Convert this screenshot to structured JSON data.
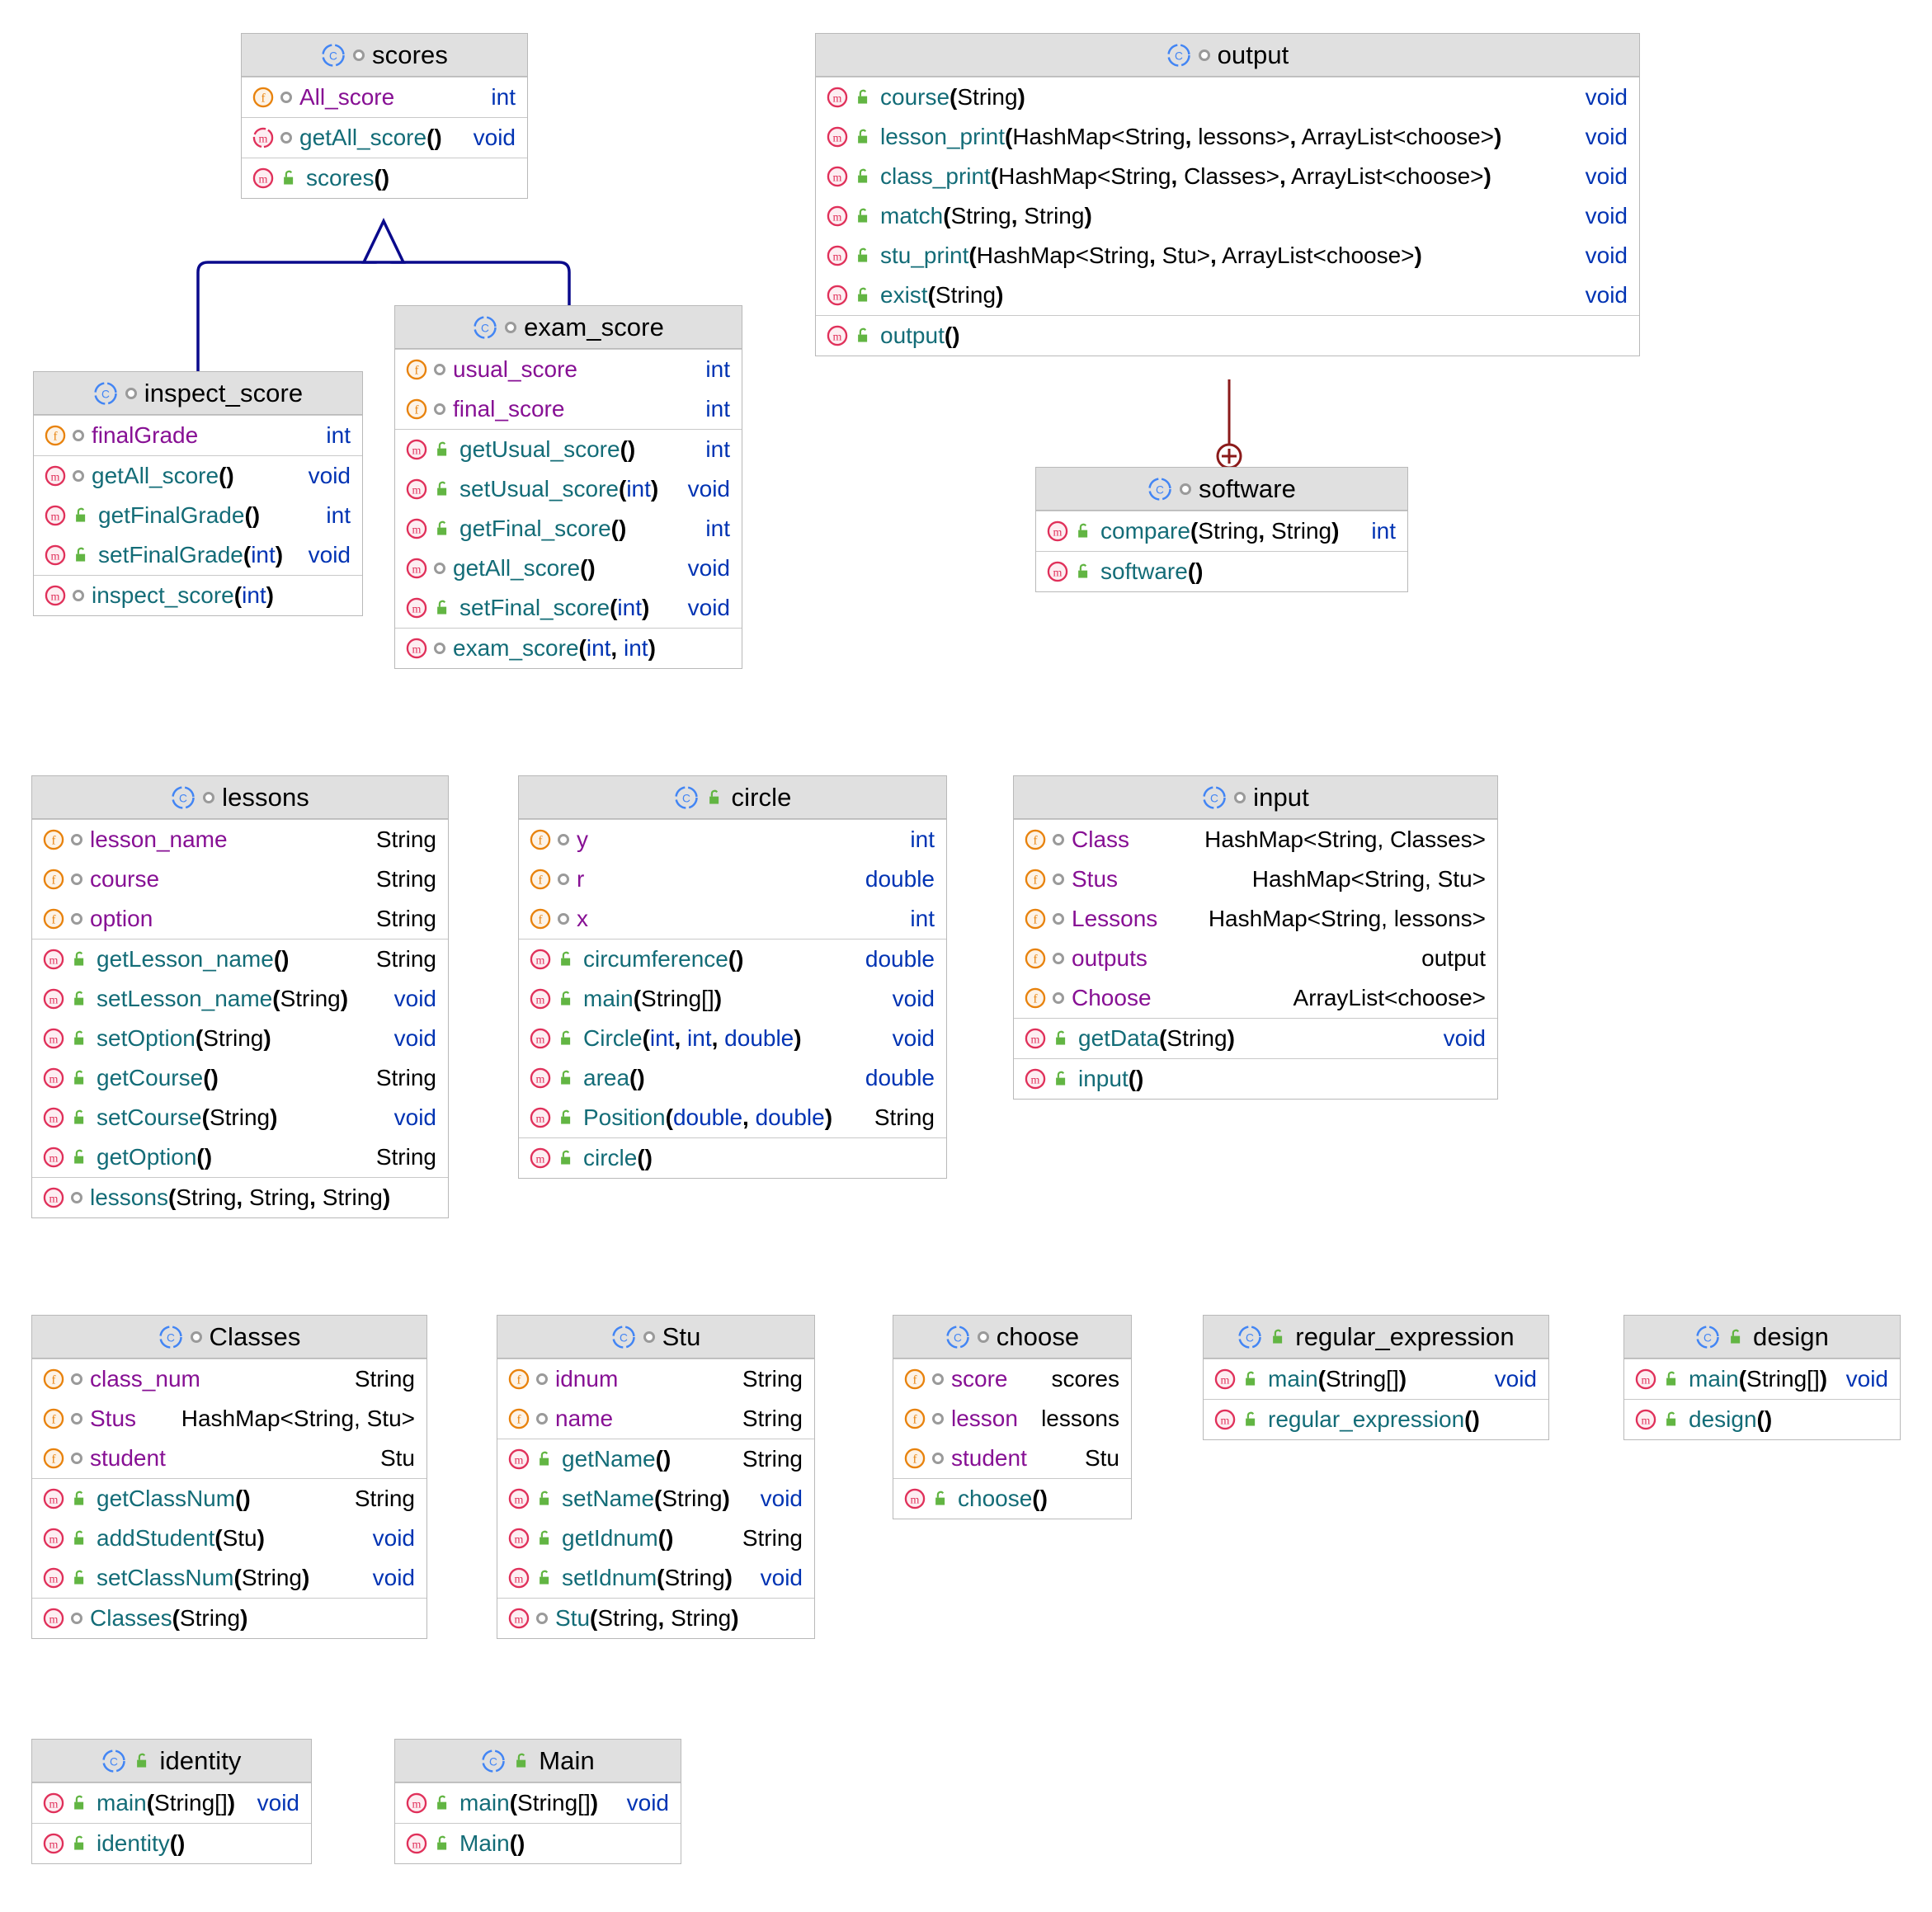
{
  "diagram": {
    "kind": "uml-class-diagram",
    "background": "#ffffff",
    "colors": {
      "header_bg": "#e0e0e0",
      "border": "#b9b9b9",
      "field_name": "#871094",
      "method_name": "#136c77",
      "primitive_type": "#0033b3",
      "object_type": "#000000",
      "class_icon": "#4285f4",
      "field_icon": "#e8820c",
      "method_icon": "#e0305a",
      "lock_icon": "#62b543",
      "inheritance_line": "#0a0a8c",
      "inner_class_line": "#8b1a1a"
    },
    "icons": {
      "class": "class-icon",
      "field": "field-icon",
      "method": "method-icon",
      "public": "public-unlock-icon",
      "package": "package-private-dot-icon"
    },
    "relations": [
      {
        "type": "inheritance",
        "from": "inspect_score",
        "to": "scores"
      },
      {
        "type": "inheritance",
        "from": "exam_score",
        "to": "scores"
      },
      {
        "type": "inner-class",
        "from": "output",
        "to": "software",
        "marker": "+"
      }
    ]
  },
  "classes": [
    {
      "id": "scores",
      "name": "scores",
      "vis": "package",
      "sections": [
        [
          {
            "k": "f",
            "v": "package",
            "sig": [
              {
                "t": "scores",
                "c": "nmF"
              }
            ],
            "type": "int",
            "tc": "tprim"
          }
        ],
        [
          {
            "k": "m",
            "v": "package",
            "sig": [
              {
                "t": "getAll_score",
                "c": "nmM"
              },
              {
                "t": "()",
                "c": "punct"
              }
            ],
            "type": "void",
            "tc": "tprim"
          }
        ],
        [
          {
            "k": "m",
            "v": "public",
            "sig": [
              {
                "t": "scores",
                "c": "nmM"
              },
              {
                "t": "()",
                "c": "punct"
              }
            ],
            "type": "",
            "tc": "tprim"
          }
        ]
      ],
      "rowtexts": [
        "All_score",
        "getAll_score()",
        "scores()"
      ]
    },
    {
      "id": "inspect_score",
      "name": "inspect_score",
      "vis": "package"
    },
    {
      "id": "exam_score",
      "name": "exam_score",
      "vis": "package"
    },
    {
      "id": "output",
      "name": "output",
      "vis": "package"
    },
    {
      "id": "software",
      "name": "software",
      "vis": "package"
    },
    {
      "id": "lessons",
      "name": "lessons",
      "vis": "package"
    },
    {
      "id": "circle",
      "name": "circle",
      "vis": "public"
    },
    {
      "id": "input",
      "name": "input",
      "vis": "package"
    },
    {
      "id": "Classes",
      "name": "Classes",
      "vis": "package"
    },
    {
      "id": "Stu",
      "name": "Stu",
      "vis": "package"
    },
    {
      "id": "choose",
      "name": "choose",
      "vis": "package"
    },
    {
      "id": "regular_expression",
      "name": "regular_expression",
      "vis": "public"
    },
    {
      "id": "design",
      "name": "design",
      "vis": "public"
    },
    {
      "id": "identity",
      "name": "identity",
      "vis": "public"
    },
    {
      "id": "Main",
      "name": "Main",
      "vis": "public"
    }
  ],
  "scores": {
    "title": "scores",
    "r0": {
      "name": "All_score",
      "type": "int"
    },
    "r1": {
      "name": "getAll_score()",
      "type": "void"
    },
    "r2": {
      "name": "scores()",
      "type": ""
    }
  },
  "inspect_score": {
    "title": "inspect_score",
    "r0": {
      "name": "finalGrade",
      "type": "int"
    },
    "r1": {
      "name": "getAll_score()",
      "type": "void"
    },
    "r2": {
      "name": "getFinalGrade()",
      "type": "int"
    },
    "r3": {
      "name": "setFinalGrade(int)",
      "type": "void"
    },
    "r4": {
      "name": "inspect_score(int)",
      "type": ""
    }
  },
  "exam_score": {
    "title": "exam_score",
    "r0": {
      "name": "usual_score",
      "type": "int"
    },
    "r1": {
      "name": "final_score",
      "type": "int"
    },
    "r2": {
      "name": "getUsual_score()",
      "type": "int"
    },
    "r3": {
      "name": "setUsual_score(int)",
      "type": "void"
    },
    "r4": {
      "name": "getFinal_score()",
      "type": "int"
    },
    "r5": {
      "name": "getAll_score()",
      "type": "void"
    },
    "r6": {
      "name": "setFinal_score(int)",
      "type": "void"
    },
    "r7": {
      "name": "exam_score(int, int)",
      "type": ""
    }
  },
  "output": {
    "title": "output",
    "r0": {
      "name": "course(String)",
      "type": "void"
    },
    "r1": {
      "name": "lesson_print(HashMap<String, lessons>, ArrayList<choose>)",
      "type": "void"
    },
    "r2": {
      "name": "class_print(HashMap<String, Classes>, ArrayList<choose>)",
      "type": "void"
    },
    "r3": {
      "name": "match(String, String)",
      "type": "void"
    },
    "r4": {
      "name": "stu_print(HashMap<String, Stu>, ArrayList<choose>)",
      "type": "void"
    },
    "r5": {
      "name": "exist(String)",
      "type": "void"
    },
    "r6": {
      "name": "output()",
      "type": ""
    }
  },
  "software": {
    "title": "software",
    "r0": {
      "name": "compare(String, String)",
      "type": "int"
    },
    "r1": {
      "name": "software()",
      "type": ""
    }
  },
  "lessons": {
    "title": "lessons",
    "r0": {
      "name": "lesson_name",
      "type": "String"
    },
    "r1": {
      "name": "course",
      "type": "String"
    },
    "r2": {
      "name": "option",
      "type": "String"
    },
    "r3": {
      "name": "getLesson_name()",
      "type": "String"
    },
    "r4": {
      "name": "setLesson_name(String)",
      "type": "void"
    },
    "r5": {
      "name": "setOption(String)",
      "type": "void"
    },
    "r6": {
      "name": "getCourse()",
      "type": "String"
    },
    "r7": {
      "name": "setCourse(String)",
      "type": "void"
    },
    "r8": {
      "name": "getOption()",
      "type": "String"
    },
    "r9": {
      "name": "lessons(String, String, String)",
      "type": ""
    }
  },
  "circle": {
    "title": "circle",
    "r0": {
      "name": "y",
      "type": "int"
    },
    "r1": {
      "name": "r",
      "type": "double"
    },
    "r2": {
      "name": "x",
      "type": "int"
    },
    "r3": {
      "name": "circumference()",
      "type": "double"
    },
    "r4": {
      "name": "main(String[])",
      "type": "void"
    },
    "r5": {
      "name": "Circle(int, int, double)",
      "type": "void"
    },
    "r6": {
      "name": "area()",
      "type": "double"
    },
    "r7": {
      "name": "Position(double, double)",
      "type": "String"
    },
    "r8": {
      "name": "circle()",
      "type": ""
    }
  },
  "input": {
    "title": "input",
    "r0": {
      "name": "Class",
      "type": "HashMap<String, Classes>"
    },
    "r1": {
      "name": "Stus",
      "type": "HashMap<String, Stu>"
    },
    "r2": {
      "name": "Lessons",
      "type": "HashMap<String, lessons>"
    },
    "r3": {
      "name": "outputs",
      "type": "output"
    },
    "r4": {
      "name": "Choose",
      "type": "ArrayList<choose>"
    },
    "r5": {
      "name": "getData(String)",
      "type": "void"
    },
    "r6": {
      "name": "input()",
      "type": ""
    }
  },
  "Classes": {
    "title": "Classes",
    "r0": {
      "name": "class_num",
      "type": "String"
    },
    "r1": {
      "name": "Stus",
      "type": "HashMap<String, Stu>"
    },
    "r2": {
      "name": "student",
      "type": "Stu"
    },
    "r3": {
      "name": "getClassNum()",
      "type": "String"
    },
    "r4": {
      "name": "addStudent(Stu)",
      "type": "void"
    },
    "r5": {
      "name": "setClassNum(String)",
      "type": "void"
    },
    "r6": {
      "name": "Classes(String)",
      "type": ""
    }
  },
  "Stu": {
    "title": "Stu",
    "r0": {
      "name": "idnum",
      "type": "String"
    },
    "r1": {
      "name": "name",
      "type": "String"
    },
    "r2": {
      "name": "getName()",
      "type": "String"
    },
    "r3": {
      "name": "setName(String)",
      "type": "void"
    },
    "r4": {
      "name": "getIdnum()",
      "type": "String"
    },
    "r5": {
      "name": "setIdnum(String)",
      "type": "void"
    },
    "r6": {
      "name": "Stu(String, String)",
      "type": ""
    }
  },
  "choose": {
    "title": "choose",
    "r0": {
      "name": "score",
      "type": "scores"
    },
    "r1": {
      "name": "lesson",
      "type": "lessons"
    },
    "r2": {
      "name": "student",
      "type": "Stu"
    },
    "r3": {
      "name": "choose()",
      "type": ""
    }
  },
  "regular_expression": {
    "title": "regular_expression",
    "r0": {
      "name": "main(String[])",
      "type": "void"
    },
    "r1": {
      "name": "regular_expression()",
      "type": ""
    }
  },
  "design": {
    "title": "design",
    "r0": {
      "name": "main(String[])",
      "type": "void"
    },
    "r1": {
      "name": "design()",
      "type": ""
    }
  },
  "identity": {
    "title": "identity",
    "r0": {
      "name": "main(String[])",
      "type": "void"
    },
    "r1": {
      "name": "identity()",
      "type": ""
    }
  },
  "Main": {
    "title": "Main",
    "r0": {
      "name": "main(String[])",
      "type": "void"
    },
    "r1": {
      "name": "Main()",
      "type": ""
    }
  }
}
